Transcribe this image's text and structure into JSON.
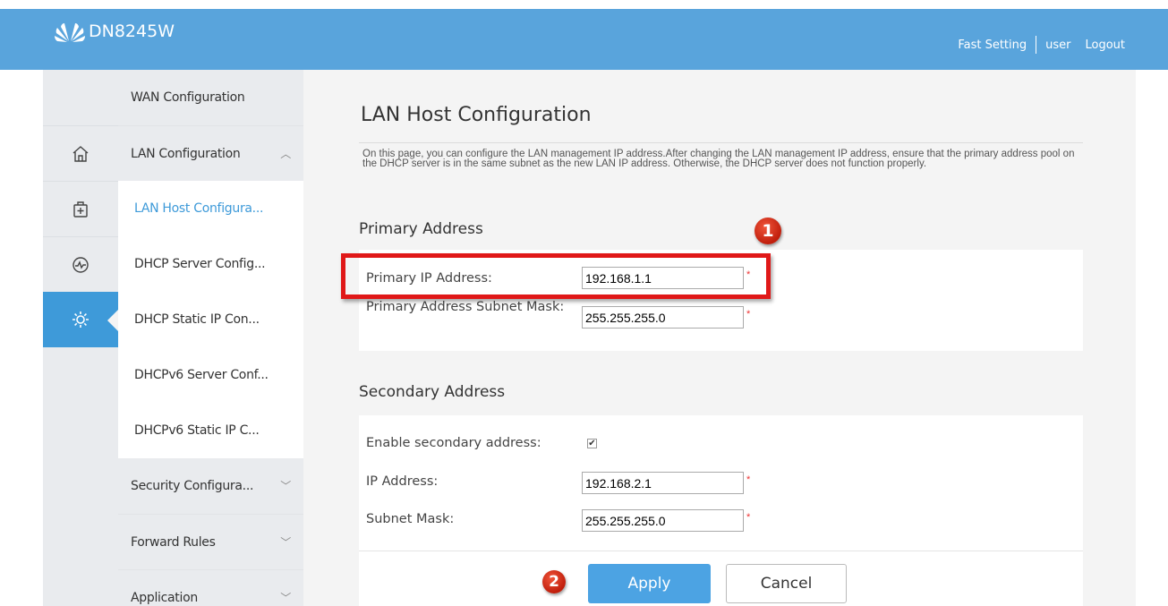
{
  "header": {
    "brand_name": "DN8245W",
    "fast_setting": "Fast Setting",
    "user": "user",
    "logout": "Logout"
  },
  "rail": {
    "icons": [
      "home-icon",
      "device-icon",
      "monitor-icon",
      "settings-icon"
    ],
    "active": "settings-icon"
  },
  "submenu": {
    "wan": "WAN Configuration",
    "lan": "LAN Configuration",
    "lan_host": "LAN Host Configura...",
    "dhcp_server": "DHCP Server Config...",
    "dhcp_static": "DHCP Static IP Con...",
    "dhcpv6_server": "DHCPv6 Server Conf...",
    "dhcpv6_static": "DHCPv6 Static IP C...",
    "security": "Security Configura...",
    "forward": "Forward Rules",
    "application": "Application"
  },
  "main": {
    "title": "LAN Host Configuration",
    "description": "On this page, you can configure the LAN management IP address.After changing the LAN management IP address, ensure that the primary address pool on the DHCP server is in the same subnet as the new LAN IP address. Otherwise, the DHCP server does not function properly.",
    "primary": {
      "heading": "Primary Address",
      "ip_label": "Primary IP Address:",
      "ip_value": "192.168.1.1",
      "mask_label": "Primary Address Subnet Mask:",
      "mask_value": "255.255.255.0"
    },
    "secondary": {
      "heading": "Secondary Address",
      "enable_label": "Enable secondary address:",
      "enabled": true,
      "ip_label": "IP Address:",
      "ip_value": "192.168.2.1",
      "mask_label": "Subnet Mask:",
      "mask_value": "255.255.255.0"
    },
    "required_mark": "*",
    "apply_label": "Apply",
    "cancel_label": "Cancel"
  },
  "annotations": {
    "step1": "1",
    "step2": "2",
    "highlight_color": "#e01818"
  },
  "colors": {
    "header": "#59a4dc",
    "accent": "#3e9ad9",
    "apply": "#4ca3e3"
  }
}
